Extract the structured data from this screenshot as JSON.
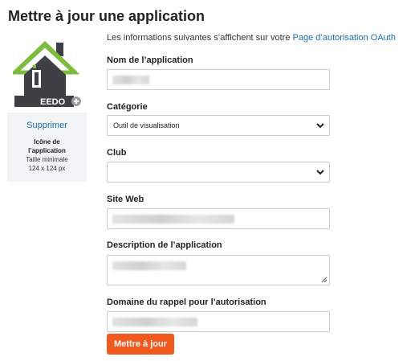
{
  "page": {
    "title": "Mettre à jour une application",
    "intro_text": "Les informations suivantes s’affichent sur votre ",
    "intro_link": "Page d’autorisation OAuth"
  },
  "icon_panel": {
    "logo_text": "EEDO",
    "delete_label": "Supprimer",
    "icon_label_1": "Icône de",
    "icon_label_2": "l’application",
    "hint_1": "Taille minimale",
    "hint_2": "124 x 124 px"
  },
  "form": {
    "name_label": "Nom de l’application",
    "category_label": "Catégorie",
    "category_value": "Outil de visualisation",
    "club_label": "Club",
    "club_value": "",
    "website_label": "Site Web",
    "description_label": "Description de l’application",
    "callback_label": "Domaine du rappel pour l’autorisation",
    "submit_label": "Mettre à jour"
  },
  "colors": {
    "link": "#1a6fb0",
    "button": "#f2591f",
    "logo_green": "#7dbb3e",
    "logo_dark": "#3d4146"
  },
  "icons": [
    "chevron-down-icon",
    "resize-handle-icon",
    "jeedom-logo"
  ]
}
